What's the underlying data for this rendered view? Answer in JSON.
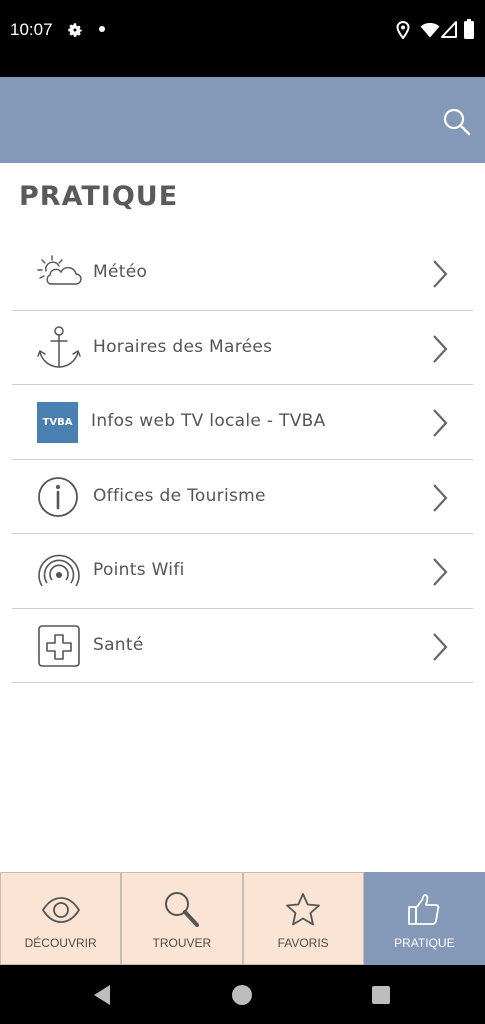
{
  "status_bar": {
    "time": "10:07"
  },
  "app_bar": {
    "accent_color": "#8498b8",
    "search_icon": "search-icon"
  },
  "page": {
    "title": "PRATIQUE"
  },
  "list": {
    "items": [
      {
        "label": "Météo",
        "icon": "weather-icon"
      },
      {
        "label": "Horaires des Marées",
        "icon": "anchor-icon"
      },
      {
        "label": "Infos web TV locale - TVBA",
        "icon": "tvba-logo",
        "badge_text": "TVBA"
      },
      {
        "label": "Offices de Tourisme",
        "icon": "info-icon"
      },
      {
        "label": "Points Wifi",
        "icon": "wifi-icon"
      },
      {
        "label": "Santé",
        "icon": "health-cross-icon"
      }
    ]
  },
  "bottom_nav": {
    "tabs": [
      {
        "label": "DÉCOUVRIR",
        "icon": "eye-icon"
      },
      {
        "label": "TROUVER",
        "icon": "magnifier-icon"
      },
      {
        "label": "FAVORIS",
        "icon": "star-icon"
      },
      {
        "label": "PRATIQUE",
        "icon": "thumbs-up-icon",
        "active": true
      }
    ],
    "tab_bg_color": "#fbe4d4",
    "active_bg_color": "#8498b8"
  }
}
